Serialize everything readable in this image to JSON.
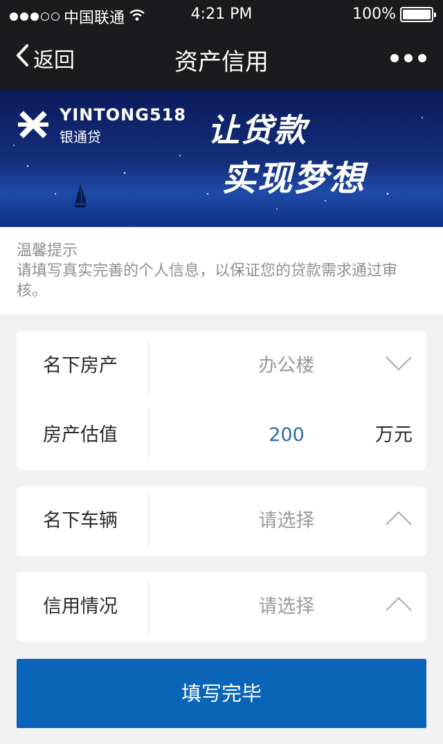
{
  "status_bar": {
    "carrier": "中国联通",
    "time": "4:21 PM",
    "battery": "100%"
  },
  "nav": {
    "back_label": "返回",
    "title": "资产信用"
  },
  "banner": {
    "brand": "YINTONG518",
    "brand_sub": "银通贷",
    "slogan_line1": "让贷款",
    "slogan_line2": "实现梦想"
  },
  "tips": {
    "title": "温馨提示",
    "text": "请填写真实完善的个人信息，以保证您的贷款需求通过审核。"
  },
  "property": {
    "label": "名下房产",
    "value": "办公楼",
    "valuation_label": "房产估值",
    "valuation_value": "200",
    "valuation_unit": "万元"
  },
  "vehicle": {
    "label": "名下车辆",
    "value": "请选择"
  },
  "credit": {
    "label": "信用情况",
    "value": "请选择"
  },
  "submit_label": "填写完毕",
  "colors": {
    "topbar": "#1b1b1d",
    "accent": "#0a64b7",
    "number": "#2a6aad"
  }
}
